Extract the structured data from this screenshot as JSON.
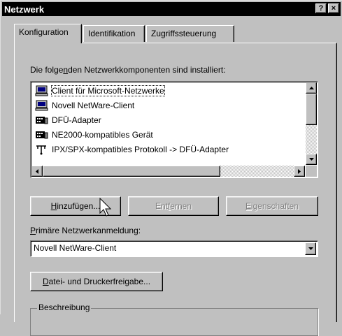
{
  "window": {
    "title": "Netzwerk",
    "help_btn": "?",
    "close_btn": "×"
  },
  "tabs": [
    {
      "label": "Konfiguration"
    },
    {
      "label": "Identifikation"
    },
    {
      "label": "Zugriffssteuerung"
    }
  ],
  "components": {
    "label_before": "Die folge",
    "label_mnemonic": "n",
    "label_after": "den Netzwerkkomponenten sind installiert:",
    "items": [
      {
        "label": "Client für Microsoft-Netzwerke",
        "icon": "network-client-icon"
      },
      {
        "label": "Novell NetWare-Client",
        "icon": "network-client-icon"
      },
      {
        "label": "DFÜ-Adapter",
        "icon": "network-adapter-icon"
      },
      {
        "label": "NE2000-kompatibles Gerät",
        "icon": "network-adapter-icon"
      },
      {
        "label": "IPX/SPX-kompatibles Protokoll -> DFÜ-Adapter",
        "icon": "protocol-icon"
      }
    ]
  },
  "buttons": {
    "add": {
      "mnemonic": "H",
      "rest": "inzufügen..."
    },
    "remove": {
      "before": "Ent",
      "mnemonic": "f",
      "rest": "ernen"
    },
    "properties": {
      "mnemonic": "E",
      "rest": "igenschaften"
    }
  },
  "logon": {
    "label_mnemonic": "P",
    "label_rest": "rimäre Netzwerkanmeldung:",
    "value": "Novell NetWare-Client"
  },
  "sharing": {
    "mnemonic": "D",
    "rest": "atei- und Druckerfreigabe..."
  },
  "description": {
    "title": "Beschreibung"
  }
}
